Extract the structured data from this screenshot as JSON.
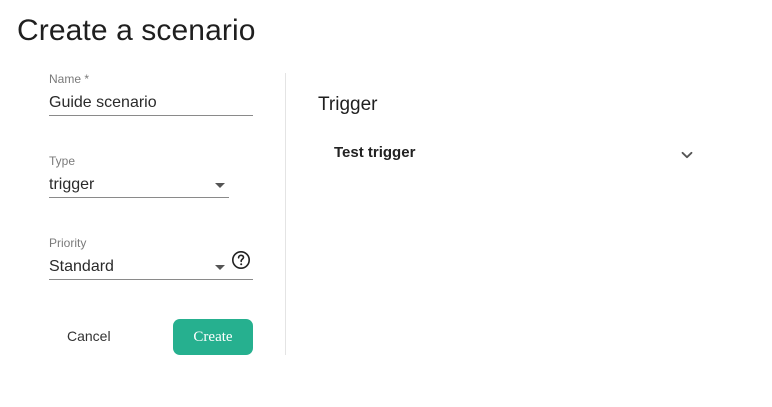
{
  "page": {
    "title": "Create a scenario"
  },
  "form": {
    "name": {
      "label": "Name *",
      "value": "Guide scenario"
    },
    "type": {
      "label": "Type",
      "value": "trigger"
    },
    "priority": {
      "label": "Priority",
      "value": "Standard"
    },
    "cancel_label": "Cancel",
    "create_label": "Create"
  },
  "trigger_panel": {
    "title": "Trigger",
    "items": [
      {
        "label": "Test trigger",
        "icon": "chevron-down-icon"
      }
    ]
  },
  "colors": {
    "accent": "#26b08f",
    "text": "#222222",
    "muted": "#7a7a7a"
  }
}
